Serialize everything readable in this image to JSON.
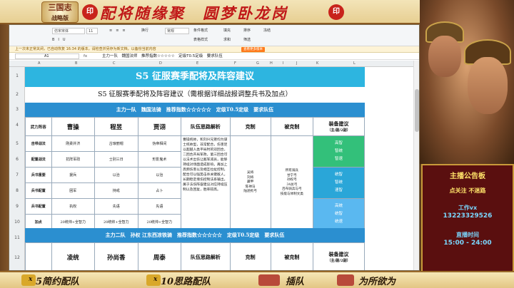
{
  "banner": {
    "logo": "三国志",
    "logo_sub": "战略版",
    "title": "配将随缘聚　圆梦卧龙岗",
    "seal": "印"
  },
  "ribbon": {
    "font": "仿宋宋体",
    "size": "11",
    "wrap": "换行",
    "format": "常规",
    "cond_format": "条件格式",
    "table_style": "表格样式",
    "fill": "填充",
    "sort": "排序",
    "freeze": "冻结",
    "sum": "求和",
    "filter": "筛选"
  },
  "notify": {
    "text": "上一次未正常关闭，已自动恢复 16:34 的版本，请检查并另存为新文档，以备份当前内容",
    "button": "查看更多版本"
  },
  "formula": {
    "cellref": "A1",
    "fx": "fx",
    "content": "主力一队　魏国法师　推荐指数☆☆☆☆☆　定级T0.5定级　要求队伍"
  },
  "columns": [
    "A",
    "B",
    "C",
    "D",
    "E",
    "F",
    "G",
    "H",
    "I",
    "J",
    "K",
    "L"
  ],
  "rows": [
    "1",
    "2",
    "3",
    "4",
    "5",
    "6",
    "7",
    "8",
    "9",
    "10",
    "11",
    "12"
  ],
  "sheet": {
    "title": "S5 征服赛季配将及阵容建议",
    "subtitle": "S5 征服赛季配将及阵容建议（需根据详细战报调整兵书及加点）",
    "team1_header": "主力一队　魏国法骑　推荐指数☆☆☆☆☆　定级T0.5定级　要求队伍",
    "team2_header": "主力二队　孙权 江东西凉铁骑　推荐指数☆☆☆☆☆　定级T0.5定级　要求队伍",
    "headers": {
      "unit": "武力阵容",
      "g1": "曹操",
      "g2": "程昱",
      "g3": "贾诩",
      "idea": "队伍思路解析",
      "counter": "克制",
      "countered": "被克制",
      "equip": "装备建议",
      "equip_sub": "（主/副/2副）"
    },
    "rows": [
      {
        "label": "自带战法",
        "c1": "刚柔并济",
        "c2": "古琅丽帽",
        "c3": "伪帝相间"
      },
      {
        "label": "配置战法",
        "c1": "抗阵军政",
        "c2": "士别三日",
        "c3": "形影鬼术"
      },
      {
        "label": "兵书重要",
        "c1": "援兵",
        "c2": "以治",
        "c3": "以治"
      },
      {
        "label": "兵书配置",
        "c1": "困军",
        "c2": "持戒",
        "c3": "占卜"
      },
      {
        "label": "兵书配置",
        "c1": "执权",
        "c2": "先语",
        "c3": "先语"
      },
      {
        "label": "加点",
        "c1": "20统帅+全智力",
        "c2": "20统帅+全智力",
        "c3": "20统帅+全智力"
      }
    ],
    "idea_text": "曹操统帅，和刘兴兄弟均为谋士统帅型，非常配合，伤害足以超越人类平局时的双回合，二回合开局军政，第三回合可以法术出伤让敌军减员，能够持续对场面造成影响，再加上高频伤害以及相互拉扯控制，配合可以强势击杀关键敌人，长期稳定增伤控制法系输出，属于法伤阵容建议对应持续压制以及回复，胜率较高。",
    "counter_text": "吴将\n刘将\n藏甲\n陈禅马\n陆逊拘弓",
    "countered_text": "所有骑兵\n甘宁弓\n孙权弓\n34总弓\n吕布骑兵与弓\n技能与体制文类",
    "equip": [
      {
        "type": "green",
        "lines": [
          "高智",
          "智统",
          "智速"
        ]
      },
      {
        "type": "blue",
        "lines": [
          "统智",
          "智统",
          "速智"
        ]
      },
      {
        "type": "lightblue",
        "lines": [
          "高统",
          "统智",
          "统速"
        ]
      }
    ],
    "row12": {
      "g1": "凌统",
      "g2": "孙尚香",
      "g3": "周泰",
      "idea": "队伍思路解析",
      "counter": "克制",
      "countered": "被克制",
      "equip": "装备建议",
      "equip_sub": "（主/副/2副）"
    }
  },
  "board": {
    "title": "主播公告板",
    "l1": "点关注 不迷路",
    "l2": "工作vx",
    "l3": "13223329526",
    "l4": "直播时间",
    "l5": "15:00 - 24:00"
  },
  "bottom": {
    "i1": "5简约配队",
    "i2": "10思路配队",
    "i3": "插队",
    "i4": "为所欲为",
    "x1": "x",
    "x2": "x"
  }
}
